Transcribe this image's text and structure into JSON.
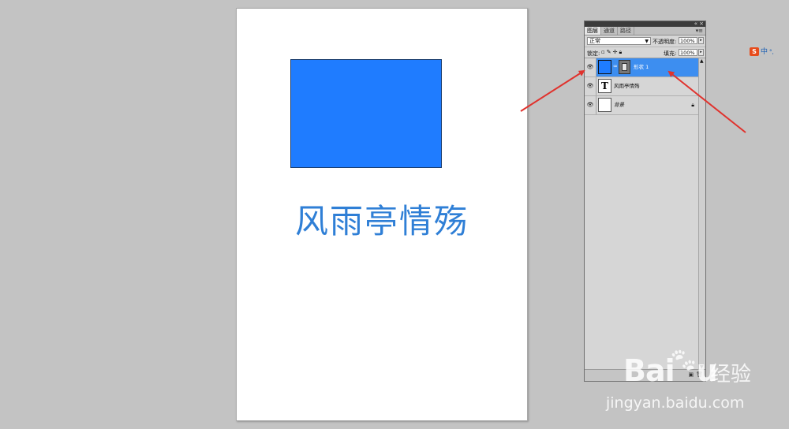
{
  "document": {
    "shape_color": "#1f7cff",
    "text": "风雨亭情殇",
    "text_color": "#2f7fd6"
  },
  "layers_panel": {
    "tabs": [
      {
        "label": "图层",
        "active": true
      },
      {
        "label": "通道",
        "active": false
      },
      {
        "label": "路径",
        "active": false
      }
    ],
    "blend_mode": "正常",
    "opacity_label": "不透明度:",
    "opacity_value": "100%",
    "lock_label": "锁定:",
    "fill_label": "填充:",
    "fill_value": "100%",
    "layers": [
      {
        "name": "形状 1",
        "selected": true
      },
      {
        "name": "风雨亭情殇",
        "selected": false
      },
      {
        "name": "背景",
        "selected": false
      }
    ]
  },
  "ime": {
    "logo": "S",
    "mode": "中",
    "extra": "°,"
  },
  "watermark": {
    "brand": "Bai",
    "brand_end": "u",
    "cn": "经验",
    "url": "jingyan.baidu.com"
  },
  "colors": {
    "annotation_arrow": "#e0322d",
    "selected_layer": "#3d8ef0"
  }
}
